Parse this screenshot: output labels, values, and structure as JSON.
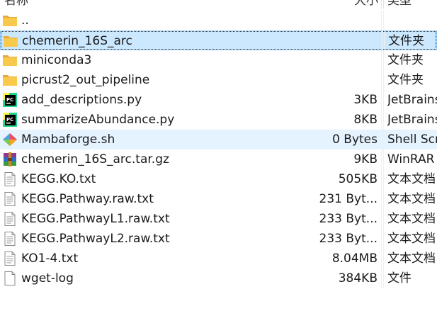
{
  "columns": {
    "name": "名称",
    "size": "大小",
    "type": "类型"
  },
  "files": [
    {
      "name": "..",
      "size": "",
      "type": "",
      "icon": "folder-icon"
    },
    {
      "name": "chemerin_16S_arc",
      "size": "",
      "type": "文件夹",
      "icon": "folder-icon",
      "state": "selected"
    },
    {
      "name": "miniconda3",
      "size": "",
      "type": "文件夹",
      "icon": "folder-icon"
    },
    {
      "name": "picrust2_out_pipeline",
      "size": "",
      "type": "文件夹",
      "icon": "folder-icon"
    },
    {
      "name": "add_descriptions.py",
      "size": "3KB",
      "type": "JetBrains",
      "icon": "pycharm-file-icon"
    },
    {
      "name": "summarizeAbundance.py",
      "size": "8KB",
      "type": "JetBrains",
      "icon": "pycharm-file-icon"
    },
    {
      "name": "Mambaforge.sh",
      "size": "0 Bytes",
      "type": "Shell Script",
      "icon": "shell-script-icon",
      "state": "hover"
    },
    {
      "name": "chemerin_16S_arc.tar.gz",
      "size": "9KB",
      "type": "WinRAR",
      "icon": "winrar-archive-icon"
    },
    {
      "name": "KEGG.KO.txt",
      "size": "505KB",
      "type": "文本文档",
      "icon": "text-file-icon"
    },
    {
      "name": "KEGG.Pathway.raw.txt",
      "size": "231 Byt...",
      "type": "文本文档",
      "icon": "text-file-icon"
    },
    {
      "name": "KEGG.PathwayL1.raw.txt",
      "size": "233 Byt...",
      "type": "文本文档",
      "icon": "text-file-icon"
    },
    {
      "name": "KEGG.PathwayL2.raw.txt",
      "size": "233 Byt...",
      "type": "文本文档",
      "icon": "text-file-icon"
    },
    {
      "name": "KO1-4.txt",
      "size": "8.04MB",
      "type": "文本文档",
      "icon": "text-file-icon"
    },
    {
      "name": "wget-log",
      "size": "384KB",
      "type": "文件",
      "icon": "blank-file-icon"
    }
  ],
  "colors": {
    "selected_bg": "#cce8ff",
    "selected_border": "#99d1ff",
    "hover_bg": "#e5f3ff",
    "folder": "#f8c94a"
  }
}
